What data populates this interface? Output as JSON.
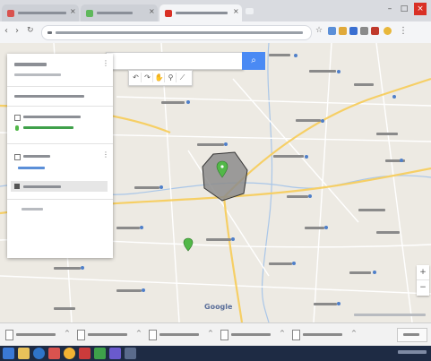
{
  "brand": {
    "map_logo": "Google"
  },
  "colors": {
    "map_bg": "#edeae3",
    "road_major": "#f6cf65",
    "road_minor": "#ffffff",
    "polygon_fill": "#8c8c8c",
    "marker": "#52b848",
    "search_button": "#4a8af4",
    "taskbar": "#1e2b44",
    "tab_close_accent": "#d93025"
  },
  "icons": {
    "search": "magnifier",
    "back": "left-arrow",
    "forward": "right-arrow",
    "reload": "circular-arrow",
    "zoom_in": "plus",
    "zoom_out": "minus",
    "marker": "map-pin"
  }
}
